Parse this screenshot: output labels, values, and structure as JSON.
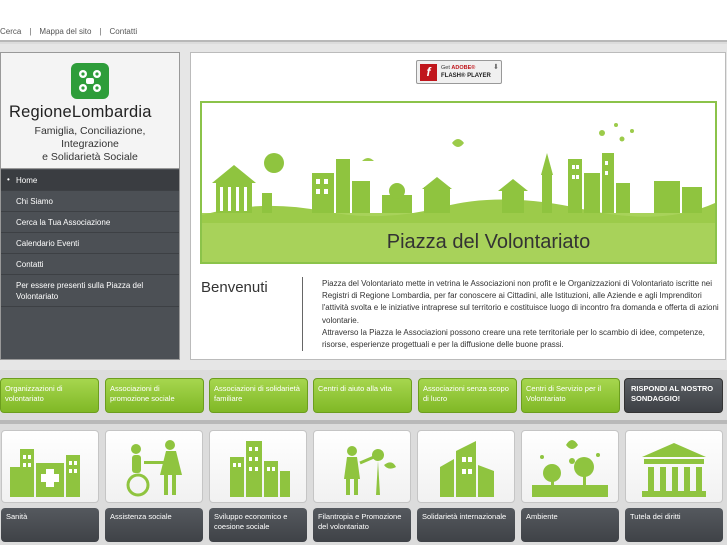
{
  "top_links": [
    "Cerca",
    "Mappa del sito",
    "Contatti"
  ],
  "top_separator": "|",
  "logo": {
    "name": "RegioneLombardia",
    "subtitle_lines": [
      "Famiglia, Conciliazione,",
      "Integrazione",
      "e Solidarietà Sociale"
    ]
  },
  "nav": [
    {
      "label": "Home"
    },
    {
      "label": "Chi Siamo"
    },
    {
      "label": "Cerca la Tua Associazione"
    },
    {
      "label": "Calendario Eventi"
    },
    {
      "label": "Contatti"
    },
    {
      "label": "Per essere presenti sulla Piazza del Volontariato"
    }
  ],
  "flash": {
    "line1_prefix": "Get",
    "line1_brand": "ADOBE®",
    "line2": "FLASH® PLAYER"
  },
  "banner": {
    "title": "Piazza del Volontariato"
  },
  "welcome": {
    "heading": "Benvenuti",
    "paragraph1": "Piazza del Volontariato mette in vetrina le Associazioni non profit e le Organizzazioni di Volontariato iscritte nei Registri di Regione Lombardia, per far conoscere ai Cittadini, alle Istituzioni, alle Aziende e agli Imprenditori l'attività svolta e le iniziative intraprese sul territorio e costituisce luogo di incontro fra domanda e offerta di azioni volontarie.",
    "paragraph2": "Attraverso la Piazza le Associazioni possono creare una rete territoriale per lo scambio di idee, competenze, risorse, esperienze progettuali e per la diffusione delle buone prassi."
  },
  "categories": [
    {
      "label": "Organizzazioni di volontariato"
    },
    {
      "label": "Associazioni di promozione sociale"
    },
    {
      "label": "Associazioni di solidarietà familiare"
    },
    {
      "label": "Centri di aiuto alla vita"
    },
    {
      "label": "Associazioni senza scopo di lucro"
    },
    {
      "label": "Centri di Servizio per il Volontariato"
    },
    {
      "label": "RISPONDI AL NOSTRO SONDAGGIO!"
    }
  ],
  "sectors": [
    {
      "label": "Sanità",
      "icon": "hospital-icon"
    },
    {
      "label": "Assistenza sociale",
      "icon": "wheelchair-icon"
    },
    {
      "label": "Sviluppo economico e coesione sociale",
      "icon": "city-icon"
    },
    {
      "label": "Filantropia e Promozione del volontariato",
      "icon": "volunteer-icon"
    },
    {
      "label": "Solidarietà internazionale",
      "icon": "globe-icon"
    },
    {
      "label": "Ambiente",
      "icon": "environment-icon"
    },
    {
      "label": "Tutela dei diritti",
      "icon": "courthouse-icon"
    }
  ],
  "colors": {
    "accent_green": "#8bc34a",
    "nav_dark": "#4c5055",
    "logo_green": "#2e9d3a",
    "flash_red": "#c0161c"
  }
}
